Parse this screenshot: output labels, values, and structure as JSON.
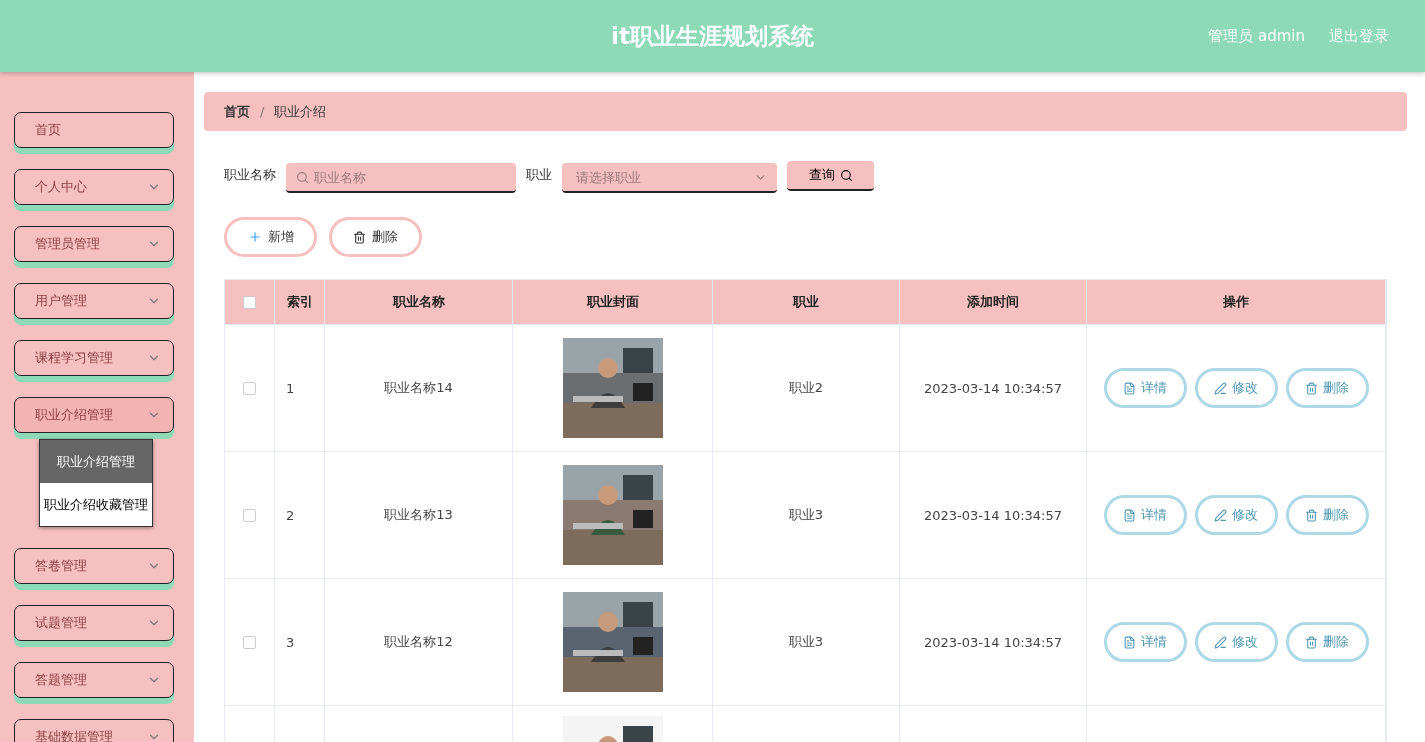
{
  "header": {
    "title": "it职业生涯规划系统",
    "user": "管理员 admin",
    "logout": "退出登录"
  },
  "sidebar": {
    "items": [
      {
        "label": "首页",
        "kind": "link",
        "expanded": false
      },
      {
        "label": "个人中心",
        "kind": "group",
        "expanded": false
      },
      {
        "label": "管理员管理",
        "kind": "group",
        "expanded": false
      },
      {
        "label": "用户管理",
        "kind": "group",
        "expanded": false
      },
      {
        "label": "课程学习管理",
        "kind": "group",
        "expanded": false
      },
      {
        "label": "职业介绍管理",
        "kind": "group",
        "expanded": true,
        "children": [
          {
            "label": "职业介绍管理",
            "selected": true
          },
          {
            "label": "职业介绍收藏管理",
            "selected": false
          }
        ]
      },
      {
        "label": "答卷管理",
        "kind": "group",
        "expanded": false
      },
      {
        "label": "试题管理",
        "kind": "group",
        "expanded": false
      },
      {
        "label": "答题管理",
        "kind": "group",
        "expanded": false
      },
      {
        "label": "基础数据管理",
        "kind": "group",
        "expanded": false
      }
    ]
  },
  "breadcrumb": {
    "items": [
      "首页",
      "职业介绍"
    ],
    "separator": "/"
  },
  "search": {
    "name_label": "职业名称",
    "name_placeholder": "职业名称",
    "job_label": "职业",
    "job_placeholder": "请选择职业",
    "query_button": "查询"
  },
  "actions": {
    "add": "新增",
    "delete": "删除"
  },
  "table": {
    "select_all_checked": false,
    "columns": [
      "索引",
      "职业名称",
      "职业封面",
      "职业",
      "添加时间",
      "操作"
    ],
    "rows": [
      {
        "checked": false,
        "index": "1",
        "name": "职业名称14",
        "cover": {
          "kind": "picture"
        },
        "job": "职业2",
        "time": "2023-03-14 10:34:57",
        "buttons": [
          "详情",
          "修改",
          "删除"
        ]
      },
      {
        "checked": false,
        "index": "2",
        "name": "职业名称13",
        "cover": {
          "kind": "picture"
        },
        "job": "职业3",
        "time": "2023-03-14 10:34:57",
        "buttons": [
          "详情",
          "修改",
          "删除"
        ]
      },
      {
        "checked": false,
        "index": "3",
        "name": "职业名称12",
        "cover": {
          "kind": "picture"
        },
        "job": "职业3",
        "time": "2023-03-14 10:34:57",
        "buttons": [
          "详情",
          "修改",
          "删除"
        ]
      },
      {
        "cover": {
          "kind": "picture"
        }
      }
    ]
  }
}
